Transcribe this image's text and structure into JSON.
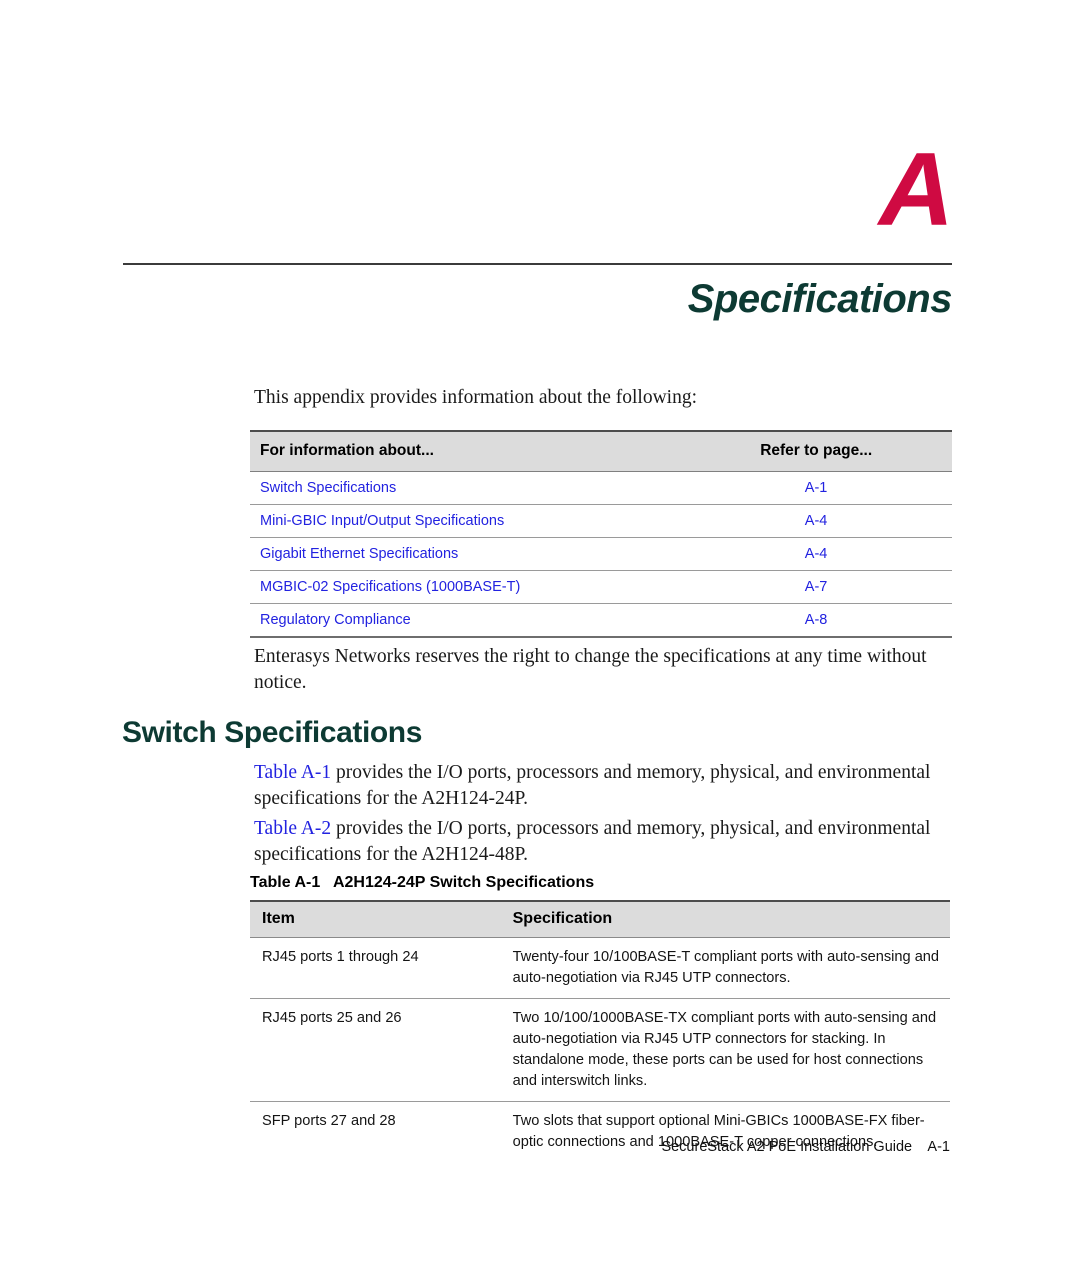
{
  "appendix": {
    "letter": "A",
    "title": "Specifications"
  },
  "colors": {
    "appendix_letter": "#cf0a42",
    "heading_green": "#0d3a33",
    "link_blue": "#2222e0",
    "table_header_gray": "#dcdcdc",
    "rule_gray": "#3b3b3b"
  },
  "intro": {
    "paragraph": "This appendix provides information about the following:"
  },
  "toc": {
    "headers": {
      "about": "For information about...",
      "page": "Refer to page..."
    },
    "rows": [
      {
        "about": "Switch Specifications",
        "page": "A-1"
      },
      {
        "about": "Mini-GBIC Input/Output Specifications",
        "page": "A-4"
      },
      {
        "about": "Gigabit Ethernet Specifications",
        "page": "A-4"
      },
      {
        "about": "MGBIC-02 Specifications (1000BASE-T)",
        "page": "A-7"
      },
      {
        "about": "Regulatory Compliance",
        "page": "A-8"
      }
    ]
  },
  "notice": {
    "paragraph": "Enterasys Networks reserves the right to change the specifications at any time without notice."
  },
  "section": {
    "heading": "Switch Specifications",
    "table_a1_intro": {
      "link": "Table A-1",
      "rest": " provides the I/O ports, processors and memory, physical, and environmental specifications for the A2H124-24P."
    },
    "table_a2_intro": {
      "link": "Table A-2",
      "rest": " provides the I/O ports, processors and memory, physical, and environmental specifications for the A2H124-48P."
    }
  },
  "spec_table": {
    "caption": "Table A-1   A2H124-24P Switch Specifications",
    "headers": {
      "item": "Item",
      "specification": "Specification"
    },
    "rows": [
      {
        "item": "RJ45 ports 1 through 24",
        "specification": "Twenty-four 10/100BASE-T compliant ports with auto-sensing and auto-negotiation via RJ45 UTP connectors."
      },
      {
        "item": "RJ45 ports 25 and 26",
        "specification": "Two 10/100/1000BASE-TX compliant ports with auto-sensing and auto-negotiation via RJ45 UTP connectors for stacking. In standalone mode, these ports can be used for host connections and interswitch links."
      },
      {
        "item": "SFP ports 27 and 28",
        "specification": "Two slots that support optional Mini-GBICs 1000BASE-FX fiber-optic connections and 1000BASE-T copper connections."
      }
    ]
  },
  "footer": {
    "text": "SecureStack A2 PoE Installation Guide    A-1"
  }
}
